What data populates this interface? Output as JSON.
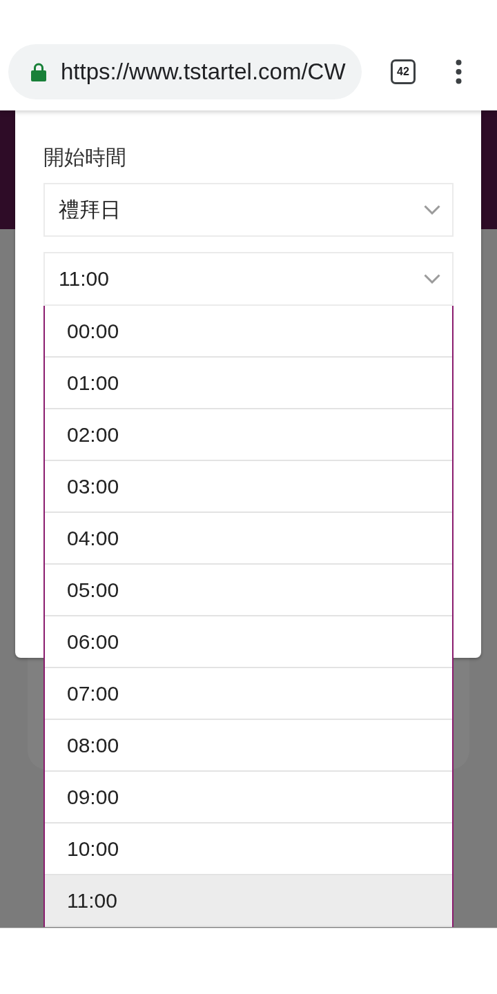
{
  "browser": {
    "url": "https://www.tstartel.com/CW",
    "tab_count": "42"
  },
  "dialog": {
    "field_label": "開始時間",
    "day_select": {
      "value": "禮拜日"
    },
    "time_select": {
      "value": "11:00",
      "expanded": true
    },
    "time_options": [
      {
        "label": "00:00",
        "selected": false
      },
      {
        "label": "01:00",
        "selected": false
      },
      {
        "label": "02:00",
        "selected": false
      },
      {
        "label": "03:00",
        "selected": false
      },
      {
        "label": "04:00",
        "selected": false
      },
      {
        "label": "05:00",
        "selected": false
      },
      {
        "label": "06:00",
        "selected": false
      },
      {
        "label": "07:00",
        "selected": false
      },
      {
        "label": "08:00",
        "selected": false
      },
      {
        "label": "09:00",
        "selected": false
      },
      {
        "label": "10:00",
        "selected": false
      },
      {
        "label": "11:00",
        "selected": true
      }
    ]
  }
}
